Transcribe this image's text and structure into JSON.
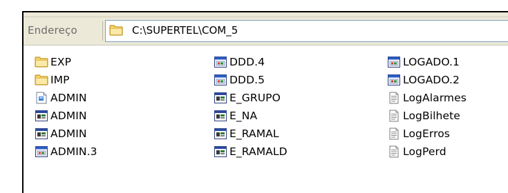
{
  "address_bar": {
    "label": "Endereço",
    "path": "C:\\SUPERTEL\\COM_5",
    "icon": "folder-icon"
  },
  "columns": [
    [
      {
        "name": "EXP",
        "icon": "folder-icon"
      },
      {
        "name": "IMP",
        "icon": "folder-icon"
      },
      {
        "name": "ADMIN",
        "icon": "exe-icon"
      },
      {
        "name": "ADMIN",
        "icon": "dos-program-icon"
      },
      {
        "name": "ADMIN",
        "icon": "dos-program-icon"
      },
      {
        "name": "ADMIN.3",
        "icon": "window-file-icon"
      }
    ],
    [
      {
        "name": "DDD.4",
        "icon": "window-file-icon"
      },
      {
        "name": "DDD.5",
        "icon": "window-file-icon"
      },
      {
        "name": "E_GRUPO",
        "icon": "dos-program-icon"
      },
      {
        "name": "E_NA",
        "icon": "dos-program-icon"
      },
      {
        "name": "E_RAMAL",
        "icon": "dos-program-icon"
      },
      {
        "name": "E_RAMALD",
        "icon": "dos-program-icon"
      }
    ],
    [
      {
        "name": "LOGADO.1",
        "icon": "window-file-icon"
      },
      {
        "name": "LOGADO.2",
        "icon": "window-file-icon"
      },
      {
        "name": "LogAlarmes",
        "icon": "text-file-icon"
      },
      {
        "name": "LogBilhete",
        "icon": "text-file-icon"
      },
      {
        "name": "LogErros",
        "icon": "text-file-icon"
      },
      {
        "name": "LogPerd",
        "icon": "text-file-icon"
      }
    ]
  ]
}
